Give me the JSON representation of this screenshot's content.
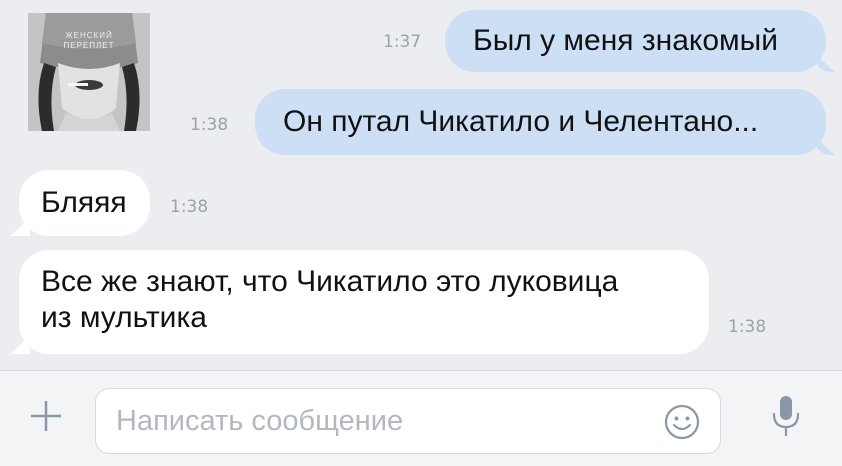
{
  "messages": [
    {
      "direction": "out",
      "text": "Был у меня знакомый",
      "time": "1:37"
    },
    {
      "direction": "out",
      "text": "Он путал Чикатило и Челентано...",
      "time": "1:38"
    },
    {
      "direction": "in",
      "text": "Бляяя",
      "time": "1:38"
    },
    {
      "direction": "in",
      "text_line1": "Все же знают, что Чикатило это луковица",
      "text_line2": "из мультика",
      "time": "1:38"
    }
  ],
  "avatar": {
    "caption": "ЖЕНСКИЙ ПЕРЕПЛЕТ"
  },
  "composer": {
    "placeholder": "Написать сообщение",
    "icons": [
      "plus-icon",
      "smiley-icon",
      "microphone-icon"
    ]
  },
  "colors": {
    "outgoing_bubble": "#cddff4",
    "incoming_bubble": "#ffffff",
    "background": "#ebedf0",
    "timestamp": "#9aa2ab",
    "icon": "#8a97a6"
  }
}
